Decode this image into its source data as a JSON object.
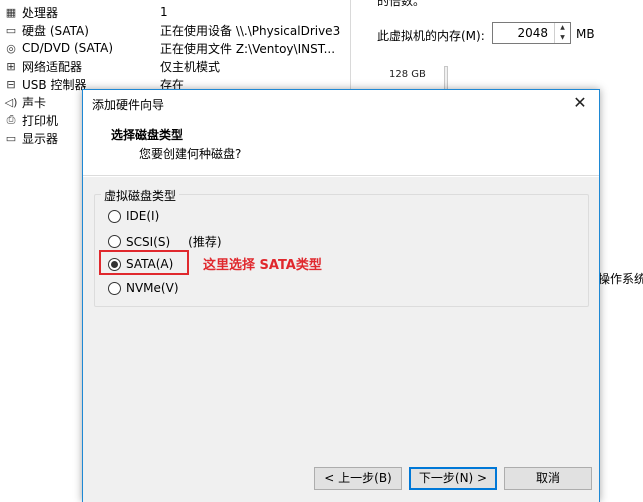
{
  "hardware_list": [
    {
      "icon": "cpu-icon",
      "glyph": "▦",
      "name": "处理器",
      "summary": "1"
    },
    {
      "icon": "hard-disk-icon",
      "glyph": "▭",
      "name": "硬盘 (SATA)",
      "summary": "正在使用设备 \\\\.\\PhysicalDrive3"
    },
    {
      "icon": "cd-dvd-icon",
      "glyph": "◎",
      "name": "CD/DVD (SATA)",
      "summary": "正在使用文件 Z:\\Ventoy\\INST..."
    },
    {
      "icon": "network-adapter-icon",
      "glyph": "⊞",
      "name": "网络适配器",
      "summary": "仅主机模式"
    },
    {
      "icon": "usb-icon",
      "glyph": "⊟",
      "name": "USB 控制器",
      "summary": "存在"
    },
    {
      "icon": "sound-card-icon",
      "glyph": "◁)",
      "name": "声卡",
      "summary": ""
    },
    {
      "icon": "printer-icon",
      "glyph": "⎙",
      "name": "打印机",
      "summary": ""
    },
    {
      "icon": "display-icon",
      "glyph": "▭",
      "name": "显示器",
      "summary": ""
    }
  ],
  "memory": {
    "top_cut_text": "的倍数。",
    "label": "此虚拟机的内存(M):",
    "value": "2048",
    "unit": "MB",
    "scale_max": "128 GB",
    "side_text": "操作系统"
  },
  "dialog": {
    "title": "添加硬件向导",
    "header_title": "选择磁盘类型",
    "header_subtitle": "您要创建何种磁盘?",
    "group_label": "虚拟磁盘类型",
    "options": [
      {
        "label": "IDE(I)",
        "checked": false
      },
      {
        "label": "SCSI(S)",
        "checked": false
      },
      {
        "label": "SATA(A)",
        "checked": true
      },
      {
        "label": "NVMe(V)",
        "checked": false
      }
    ],
    "recommended_text": "(推荐)",
    "annotation": "这里选择 SATA类型",
    "buttons": {
      "back": "< 上一步(B)",
      "next": "下一步(N) >",
      "cancel": "取消"
    }
  },
  "colors": {
    "accent": "#0078d7",
    "annotation_red": "#e0282d",
    "dialog_border": "#1e88d4"
  }
}
